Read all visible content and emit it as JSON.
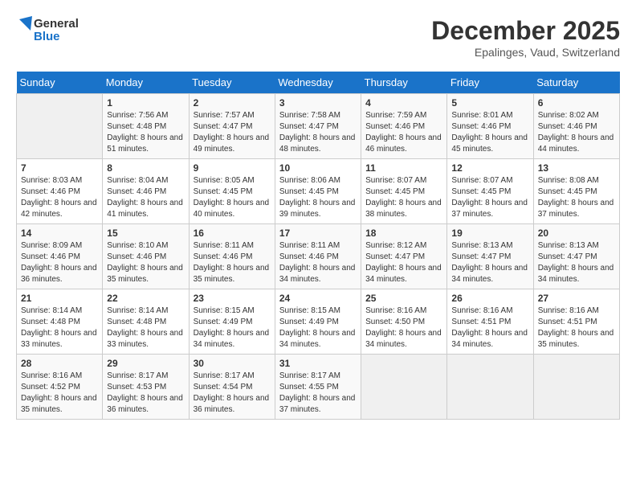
{
  "header": {
    "logo_line1": "General",
    "logo_line2": "Blue",
    "month": "December 2025",
    "location": "Epalinges, Vaud, Switzerland"
  },
  "weekdays": [
    "Sunday",
    "Monday",
    "Tuesday",
    "Wednesday",
    "Thursday",
    "Friday",
    "Saturday"
  ],
  "weeks": [
    [
      {
        "day": "",
        "empty": true
      },
      {
        "day": "1",
        "sunrise": "7:56 AM",
        "sunset": "4:48 PM",
        "daylight": "8 hours and 51 minutes."
      },
      {
        "day": "2",
        "sunrise": "7:57 AM",
        "sunset": "4:47 PM",
        "daylight": "8 hours and 49 minutes."
      },
      {
        "day": "3",
        "sunrise": "7:58 AM",
        "sunset": "4:47 PM",
        "daylight": "8 hours and 48 minutes."
      },
      {
        "day": "4",
        "sunrise": "7:59 AM",
        "sunset": "4:46 PM",
        "daylight": "8 hours and 46 minutes."
      },
      {
        "day": "5",
        "sunrise": "8:01 AM",
        "sunset": "4:46 PM",
        "daylight": "8 hours and 45 minutes."
      },
      {
        "day": "6",
        "sunrise": "8:02 AM",
        "sunset": "4:46 PM",
        "daylight": "8 hours and 44 minutes."
      }
    ],
    [
      {
        "day": "7",
        "sunrise": "8:03 AM",
        "sunset": "4:46 PM",
        "daylight": "8 hours and 42 minutes."
      },
      {
        "day": "8",
        "sunrise": "8:04 AM",
        "sunset": "4:46 PM",
        "daylight": "8 hours and 41 minutes."
      },
      {
        "day": "9",
        "sunrise": "8:05 AM",
        "sunset": "4:45 PM",
        "daylight": "8 hours and 40 minutes."
      },
      {
        "day": "10",
        "sunrise": "8:06 AM",
        "sunset": "4:45 PM",
        "daylight": "8 hours and 39 minutes."
      },
      {
        "day": "11",
        "sunrise": "8:07 AM",
        "sunset": "4:45 PM",
        "daylight": "8 hours and 38 minutes."
      },
      {
        "day": "12",
        "sunrise": "8:07 AM",
        "sunset": "4:45 PM",
        "daylight": "8 hours and 37 minutes."
      },
      {
        "day": "13",
        "sunrise": "8:08 AM",
        "sunset": "4:45 PM",
        "daylight": "8 hours and 37 minutes."
      }
    ],
    [
      {
        "day": "14",
        "sunrise": "8:09 AM",
        "sunset": "4:46 PM",
        "daylight": "8 hours and 36 minutes."
      },
      {
        "day": "15",
        "sunrise": "8:10 AM",
        "sunset": "4:46 PM",
        "daylight": "8 hours and 35 minutes."
      },
      {
        "day": "16",
        "sunrise": "8:11 AM",
        "sunset": "4:46 PM",
        "daylight": "8 hours and 35 minutes."
      },
      {
        "day": "17",
        "sunrise": "8:11 AM",
        "sunset": "4:46 PM",
        "daylight": "8 hours and 34 minutes."
      },
      {
        "day": "18",
        "sunrise": "8:12 AM",
        "sunset": "4:47 PM",
        "daylight": "8 hours and 34 minutes."
      },
      {
        "day": "19",
        "sunrise": "8:13 AM",
        "sunset": "4:47 PM",
        "daylight": "8 hours and 34 minutes."
      },
      {
        "day": "20",
        "sunrise": "8:13 AM",
        "sunset": "4:47 PM",
        "daylight": "8 hours and 34 minutes."
      }
    ],
    [
      {
        "day": "21",
        "sunrise": "8:14 AM",
        "sunset": "4:48 PM",
        "daylight": "8 hours and 33 minutes."
      },
      {
        "day": "22",
        "sunrise": "8:14 AM",
        "sunset": "4:48 PM",
        "daylight": "8 hours and 33 minutes."
      },
      {
        "day": "23",
        "sunrise": "8:15 AM",
        "sunset": "4:49 PM",
        "daylight": "8 hours and 34 minutes."
      },
      {
        "day": "24",
        "sunrise": "8:15 AM",
        "sunset": "4:49 PM",
        "daylight": "8 hours and 34 minutes."
      },
      {
        "day": "25",
        "sunrise": "8:16 AM",
        "sunset": "4:50 PM",
        "daylight": "8 hours and 34 minutes."
      },
      {
        "day": "26",
        "sunrise": "8:16 AM",
        "sunset": "4:51 PM",
        "daylight": "8 hours and 34 minutes."
      },
      {
        "day": "27",
        "sunrise": "8:16 AM",
        "sunset": "4:51 PM",
        "daylight": "8 hours and 35 minutes."
      }
    ],
    [
      {
        "day": "28",
        "sunrise": "8:16 AM",
        "sunset": "4:52 PM",
        "daylight": "8 hours and 35 minutes."
      },
      {
        "day": "29",
        "sunrise": "8:17 AM",
        "sunset": "4:53 PM",
        "daylight": "8 hours and 36 minutes."
      },
      {
        "day": "30",
        "sunrise": "8:17 AM",
        "sunset": "4:54 PM",
        "daylight": "8 hours and 36 minutes."
      },
      {
        "day": "31",
        "sunrise": "8:17 AM",
        "sunset": "4:55 PM",
        "daylight": "8 hours and 37 minutes."
      },
      {
        "day": "",
        "empty": true
      },
      {
        "day": "",
        "empty": true
      },
      {
        "day": "",
        "empty": true
      }
    ]
  ]
}
